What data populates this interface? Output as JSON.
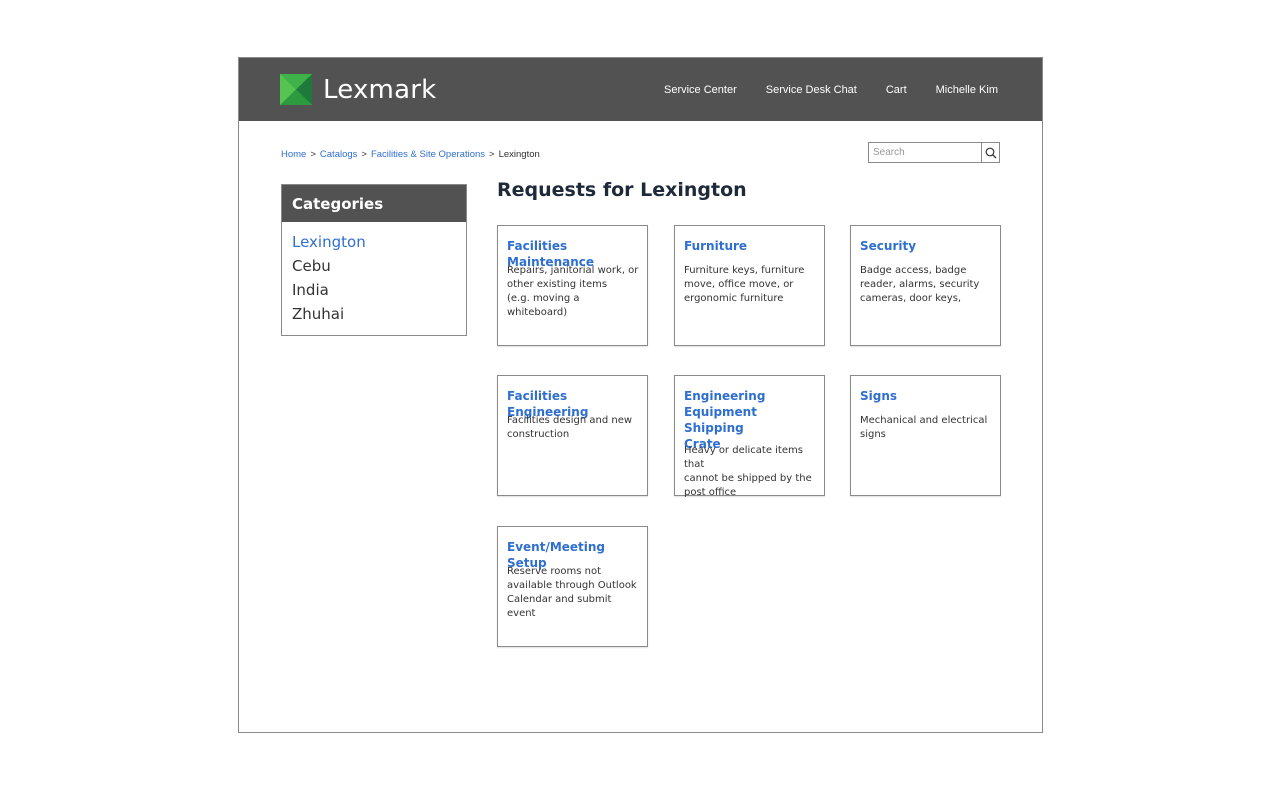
{
  "header": {
    "brand": "Lexmark",
    "nav": [
      "Service Center",
      "Service Desk Chat",
      "Cart",
      "Michelle Kim"
    ],
    "logo_colors": [
      "#3fb24a",
      "#1e7a3a"
    ]
  },
  "breadcrumb": {
    "items": [
      "Home",
      "Catalogs",
      "Facilities & Site Operations"
    ],
    "current": "Lexington",
    "separator": ">"
  },
  "search": {
    "placeholder": "Search",
    "icon": "search-icon"
  },
  "categories": {
    "title": "Categories",
    "items": [
      "Lexington",
      "Cebu",
      "India",
      "Zhuhai"
    ],
    "active_index": 0
  },
  "page_title": "Requests for Lexington",
  "cards": [
    {
      "title": "Facilities Maintenance",
      "desc": "Repairs, janitorial work, or\nother existing items\n(e.g. moving a whiteboard)"
    },
    {
      "title": "Furniture",
      "desc": "Furniture keys, furniture\nmove, office move, or\nergonomic furniture"
    },
    {
      "title": "Security",
      "desc": "Badge access, badge\nreader, alarms, security\ncameras, door keys,"
    },
    {
      "title": "Facilities Engineering",
      "desc": "Facilities design and new\nconstruction"
    },
    {
      "title": "Engineering\nEquipment Shipping\nCrate",
      "desc": "Heavy or delicate items that\ncannot be shipped by the\npost office"
    },
    {
      "title": "Signs",
      "desc": "Mechanical and electrical\nsigns"
    },
    {
      "title": "Event/Meeting Setup",
      "desc": "Reserve rooms not\navailable through Outlook\nCalendar and submit event"
    }
  ],
  "colors": {
    "header_bg": "#525252",
    "link": "#2f6fcf",
    "title": "#1e2a3a"
  }
}
